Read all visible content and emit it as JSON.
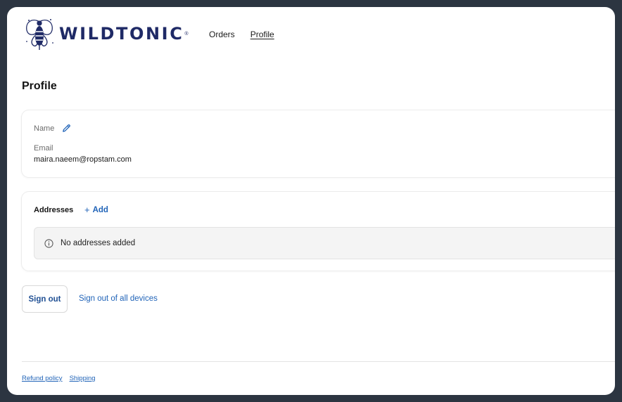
{
  "brand": {
    "name": "WILDTONIC",
    "registered": "®",
    "color": "#1f2a66"
  },
  "nav": {
    "items": [
      {
        "label": "Orders",
        "active": false
      },
      {
        "label": "Profile",
        "active": true
      }
    ]
  },
  "page": {
    "title": "Profile"
  },
  "profile": {
    "name_label": "Name",
    "email_label": "Email",
    "email_value": "maira.naeem@ropstam.com"
  },
  "addresses": {
    "title": "Addresses",
    "add_label": "Add",
    "empty_text": "No addresses added"
  },
  "actions": {
    "sign_out": "Sign out",
    "sign_out_all": "Sign out of all devices"
  },
  "footer": {
    "links": [
      {
        "label": "Refund policy"
      },
      {
        "label": "Shipping"
      }
    ]
  },
  "colors": {
    "accent": "#2164b8",
    "frame": "#2c3541"
  },
  "icons": {
    "edit": "pencil-icon",
    "info": "info-icon",
    "add": "plus-icon"
  }
}
